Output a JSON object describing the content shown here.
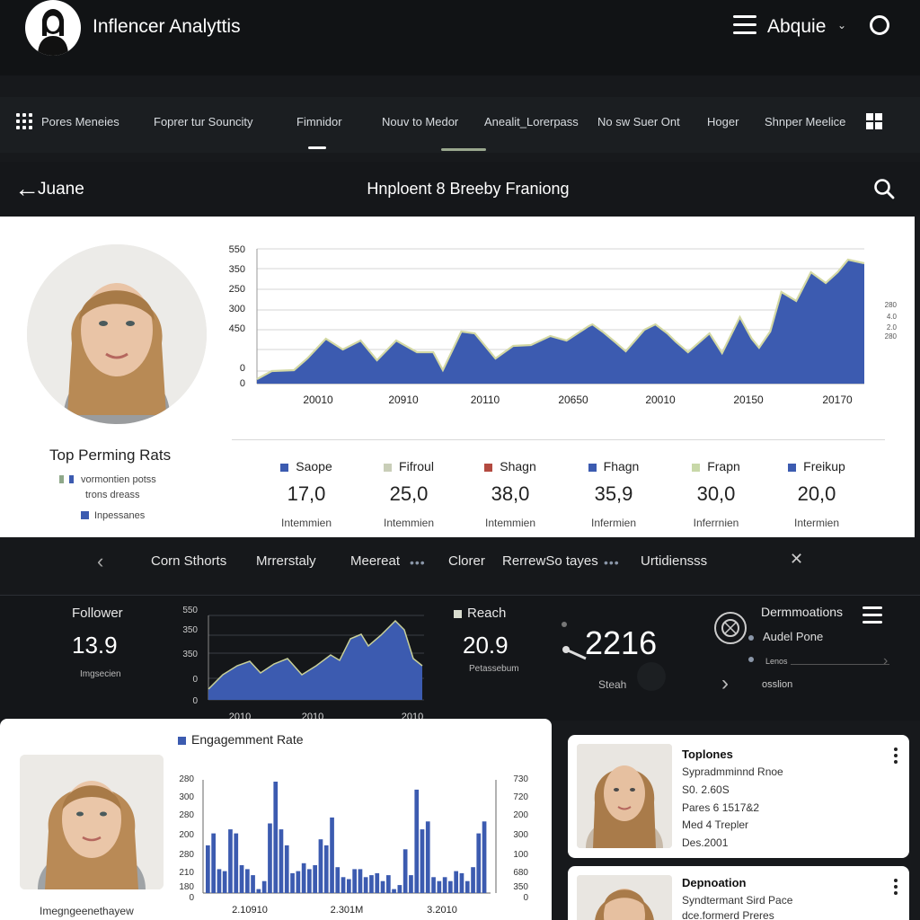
{
  "header": {
    "title": "Inflencer Analyttis",
    "user": "Abquie"
  },
  "nav": {
    "items": [
      "Pores Meneies",
      "Foprer tur Souncity",
      "Fimnidor",
      "Nouv to Medor",
      "Anealit_Lorerpass",
      "No sw Suer Ont",
      "Hoger",
      "Shnper Meelice"
    ]
  },
  "subheader": {
    "back_label": "Juane",
    "title": "Hnploent 8 Breeby Franiong"
  },
  "profile": {
    "heading": "Top Perming Rats",
    "legend": [
      "vormontien potss",
      "trons dreass",
      "Inpessanes"
    ]
  },
  "main_chart": {
    "y_ticks_left": [
      "550",
      "350",
      "250",
      "300",
      "450",
      "0",
      "0"
    ],
    "y_ticks_right": [
      "280",
      "4.0",
      "2.0",
      "280"
    ],
    "x_ticks": [
      "20010",
      "20910",
      "20110",
      "20650",
      "20010",
      "20150",
      "20170"
    ],
    "color": "#3c5bb0"
  },
  "stats": [
    {
      "label": "Saope",
      "value": "17,0",
      "sub": "Intemmien",
      "color": "#3c5bb0"
    },
    {
      "label": "Fifroul",
      "value": "25,0",
      "sub": "Intemmien",
      "color": "#c9ceb8"
    },
    {
      "label": "Shagn",
      "value": "38,0",
      "sub": "Intemmien",
      "color": "#b34a40"
    },
    {
      "label": "Fhagn",
      "value": "35,9",
      "sub": "Infermien",
      "color": "#3c5bb0"
    },
    {
      "label": "Frapn",
      "value": "30,0",
      "sub": "Inferrnien",
      "color": "#c8d8a8"
    },
    {
      "label": "Freikup",
      "value": "20,0",
      "sub": "Intermien",
      "color": "#3c5bb0"
    }
  ],
  "tabs2": {
    "items": [
      "Corn Sthorts",
      "Mrrerstaly",
      "Meereat",
      "Clorer",
      "RerrewSo tayes",
      "Urtidiensss"
    ],
    "ellipsis": "•••"
  },
  "metrics": {
    "follower": {
      "label": "Follower",
      "value": "13.9",
      "sub": "Imgsecien"
    },
    "mini_chart": {
      "y_ticks": [
        "550",
        "350",
        "350",
        "0",
        "0"
      ],
      "x_ticks": [
        "2010",
        "2010",
        "2010"
      ]
    },
    "reach": {
      "label": "Reach",
      "value": "20.9",
      "sub": "Petassebum"
    },
    "gauge": {
      "value": "2216",
      "sub": "Steah"
    },
    "demo": {
      "title": "Dermmoations",
      "item1": "Audel Pone",
      "item2": "Lenos",
      "item3": "osslion"
    }
  },
  "engagement": {
    "title": "Engagemment Rate",
    "caption": "Imegngeenethayew",
    "y_left": [
      "280",
      "300",
      "280",
      "200",
      "280",
      "210",
      "180",
      "0"
    ],
    "y_right": [
      "730",
      "720",
      "200",
      "300",
      "100",
      "680",
      "350",
      "0"
    ],
    "x_ticks": [
      "2.10910",
      "2.301M",
      "3.2010"
    ],
    "values": [
      120,
      150,
      60,
      55,
      160,
      150,
      70,
      60,
      45,
      10,
      30,
      175,
      280,
      160,
      120,
      50,
      55,
      75,
      60,
      70,
      135,
      120,
      190,
      65,
      40,
      35,
      60,
      60,
      40,
      45,
      50,
      30,
      45,
      10,
      20,
      110,
      45,
      260,
      160,
      180,
      40,
      30,
      40,
      30,
      55,
      50,
      30,
      65,
      150,
      180
    ]
  },
  "cards": [
    {
      "title": "Toplones",
      "lines": [
        "Sypradmminnd Rnoe",
        "S0. 2.60S",
        "Pares 6 1517&2",
        "Med 4 Trepler",
        "Des.2001"
      ]
    },
    {
      "title": "Depnoation",
      "lines": [
        "Syndtermant Sird Pace",
        "dce.formerd Preres"
      ]
    }
  ]
}
